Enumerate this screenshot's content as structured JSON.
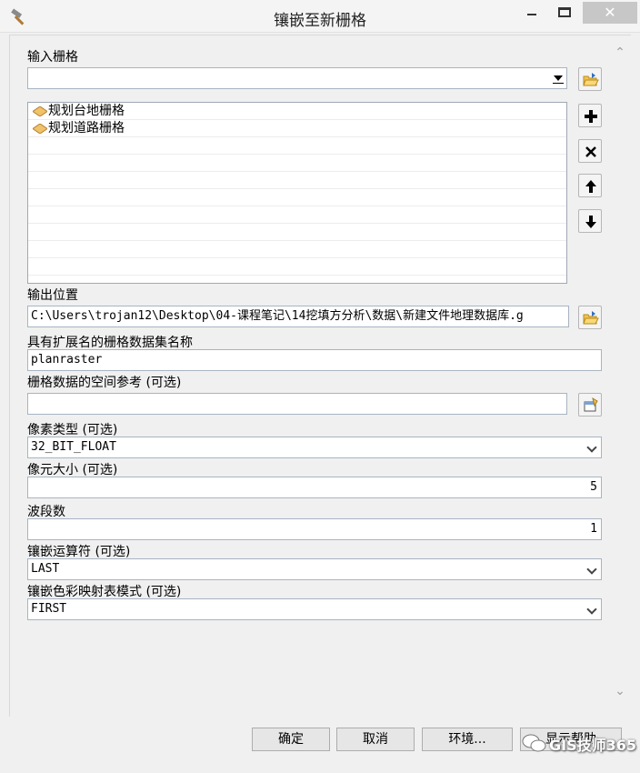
{
  "window": {
    "title": "镶嵌至新栅格"
  },
  "input_rasters": {
    "label": "输入栅格",
    "value": "",
    "items": [
      "规划台地栅格",
      "规划道路栅格"
    ]
  },
  "output_location": {
    "label": "输出位置",
    "value": "C:\\Users\\trojan12\\Desktop\\04-课程笔记\\14挖填方分析\\数据\\新建文件地理数据库.g"
  },
  "dataset_name": {
    "label": "具有扩展名的栅格数据集名称",
    "value": "planraster"
  },
  "spatial_reference": {
    "label": "栅格数据的空间参考 (可选)",
    "value": ""
  },
  "pixel_type": {
    "label": "像素类型 (可选)",
    "value": "32_BIT_FLOAT"
  },
  "cell_size": {
    "label": "像元大小 (可选)",
    "value": "5"
  },
  "bands": {
    "label": "波段数",
    "value": "1"
  },
  "mosaic_operator": {
    "label": "镶嵌运算符 (可选)",
    "value": "LAST"
  },
  "colormap_mode": {
    "label": "镶嵌色彩映射表模式 (可选)",
    "value": "FIRST"
  },
  "buttons": {
    "ok": "确定",
    "cancel": "取消",
    "env": "环境...",
    "help": "显示帮助"
  },
  "watermark": "GIS技师365",
  "colors": {
    "field_border": "#a8b4c2",
    "background": "#f0f0f0",
    "close_button": "#c7c7c7"
  }
}
